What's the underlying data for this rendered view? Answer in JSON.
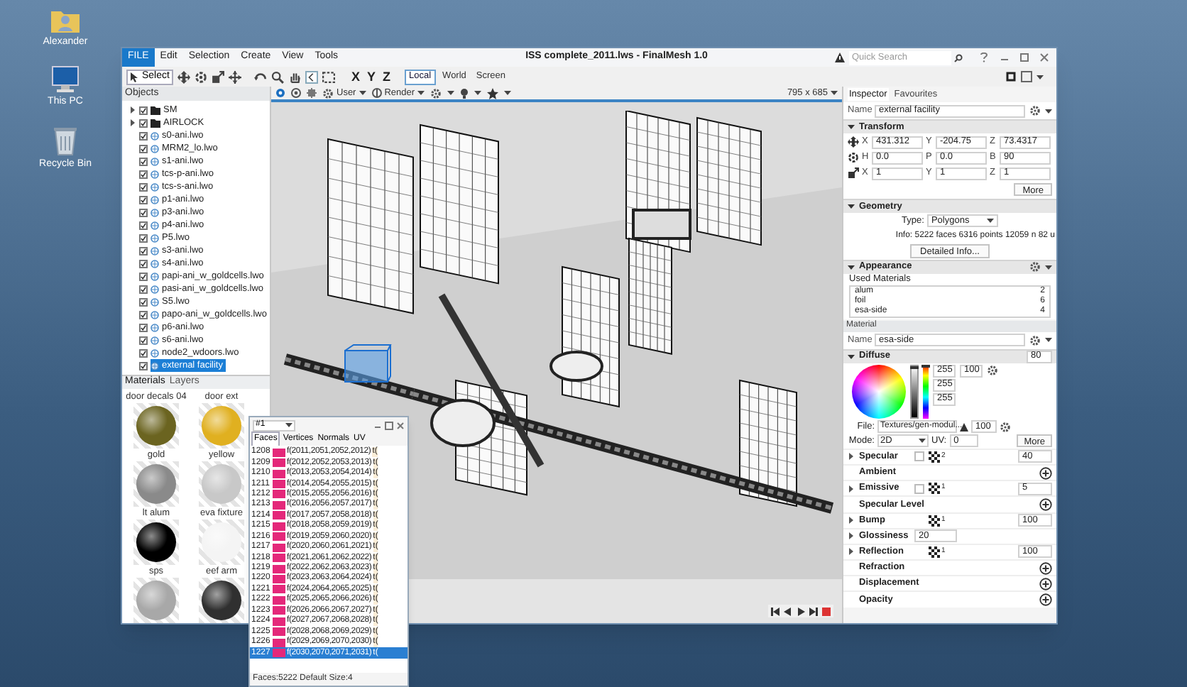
{
  "desktop_icons": [
    {
      "label": "Alexander",
      "kind": "user"
    },
    {
      "label": "This PC",
      "kind": "computer"
    },
    {
      "label": "Recycle Bin",
      "kind": "bin"
    }
  ],
  "window": {
    "title": "ISS complete_2011.lws - FinalMesh 1.0",
    "quick_search": {
      "placeholder": "Quick Search"
    },
    "menu": [
      {
        "label": "FILE",
        "selected": true
      },
      {
        "label": "Edit",
        "selected": false
      },
      {
        "label": "Selection",
        "selected": false
      },
      {
        "label": "Create",
        "selected": false
      },
      {
        "label": "View",
        "selected": false
      },
      {
        "label": "Tools",
        "selected": false
      }
    ]
  },
  "toolbar": {
    "select": "Select",
    "axes": [
      "X",
      "Y",
      "Z"
    ],
    "spaces": [
      {
        "label": "Local",
        "selected": true
      },
      {
        "label": "World",
        "selected": false
      },
      {
        "label": "Screen",
        "selected": false
      }
    ]
  },
  "objects": {
    "title": "Objects",
    "items": [
      {
        "label": "SM",
        "kind": "group",
        "expanded": false,
        "checked": true,
        "selected": false
      },
      {
        "label": "AIRLOCK",
        "kind": "group",
        "expanded": false,
        "checked": true,
        "selected": false
      },
      {
        "label": "s0-ani.lwo",
        "kind": "mesh",
        "checked": true,
        "selected": false
      },
      {
        "label": "MRM2_lo.lwo",
        "kind": "mesh",
        "checked": true,
        "selected": false
      },
      {
        "label": "s1-ani.lwo",
        "kind": "mesh",
        "checked": true,
        "selected": false
      },
      {
        "label": "tcs-p-ani.lwo",
        "kind": "mesh",
        "checked": true,
        "selected": false
      },
      {
        "label": "tcs-s-ani.lwo",
        "kind": "mesh",
        "checked": true,
        "selected": false
      },
      {
        "label": "p1-ani.lwo",
        "kind": "mesh",
        "checked": true,
        "selected": false
      },
      {
        "label": "p3-ani.lwo",
        "kind": "mesh",
        "checked": true,
        "selected": false
      },
      {
        "label": "p4-ani.lwo",
        "kind": "mesh",
        "checked": true,
        "selected": false
      },
      {
        "label": "P5.lwo",
        "kind": "mesh",
        "checked": true,
        "selected": false
      },
      {
        "label": "s3-ani.lwo",
        "kind": "mesh",
        "checked": true,
        "selected": false
      },
      {
        "label": "s4-ani.lwo",
        "kind": "mesh",
        "checked": true,
        "selected": false
      },
      {
        "label": "papi-ani_w_goldcells.lwo",
        "kind": "mesh",
        "checked": true,
        "selected": false
      },
      {
        "label": "pasi-ani_w_goldcells.lwo",
        "kind": "mesh",
        "checked": true,
        "selected": false
      },
      {
        "label": "S5.lwo",
        "kind": "mesh",
        "checked": true,
        "selected": false
      },
      {
        "label": "papo-ani_w_goldcells.lwo",
        "kind": "mesh",
        "checked": true,
        "selected": false
      },
      {
        "label": "p6-ani.lwo",
        "kind": "mesh",
        "checked": true,
        "selected": false
      },
      {
        "label": "s6-ani.lwo",
        "kind": "mesh",
        "checked": true,
        "selected": false
      },
      {
        "label": "node2_wdoors.lwo",
        "kind": "mesh",
        "checked": true,
        "selected": false
      },
      {
        "label": "external facility",
        "kind": "mesh",
        "checked": true,
        "selected": true
      }
    ]
  },
  "materials": {
    "tabs": [
      {
        "label": "Materials",
        "selected": true
      },
      {
        "label": "Layers",
        "selected": false
      }
    ],
    "items": [
      {
        "name": "door decals 04",
        "color": "#6b6420"
      },
      {
        "name": "door ext",
        "color": "#e0b020"
      },
      {
        "name": "gold",
        "color": "#8a8a8a"
      },
      {
        "name": "yellow",
        "color": "#c8c8c8"
      },
      {
        "name": "lt alum",
        "color": "#000000"
      },
      {
        "name": "eva fixture",
        "color": "#f4f4f4"
      },
      {
        "name": "sps",
        "color": "#a8a8a8"
      },
      {
        "name": "eef arm",
        "color": "#303030"
      }
    ]
  },
  "viewport": {
    "camera": "User",
    "render": "Render",
    "size": "795 x 685"
  },
  "faces_window": {
    "selector": "#1",
    "tabs": [
      {
        "label": "Faces",
        "selected": true
      },
      {
        "label": "Vertices",
        "selected": false
      },
      {
        "label": "Normals",
        "selected": false
      },
      {
        "label": "UV",
        "selected": false
      }
    ],
    "rows": [
      {
        "index": "1208",
        "face": "f(2011,2051,2052,2012)",
        "extra": "t(",
        "selected": false
      },
      {
        "index": "1209",
        "face": "f(2012,2052,2053,2013)",
        "extra": "t(",
        "selected": false
      },
      {
        "index": "1210",
        "face": "f(2013,2053,2054,2014)",
        "extra": "t(",
        "selected": false
      },
      {
        "index": "1211",
        "face": "f(2014,2054,2055,2015)",
        "extra": "t(",
        "selected": false
      },
      {
        "index": "1212",
        "face": "f(2015,2055,2056,2016)",
        "extra": "t(",
        "selected": false
      },
      {
        "index": "1213",
        "face": "f(2016,2056,2057,2017)",
        "extra": "t(",
        "selected": false
      },
      {
        "index": "1214",
        "face": "f(2017,2057,2058,2018)",
        "extra": "t(",
        "selected": false
      },
      {
        "index": "1215",
        "face": "f(2018,2058,2059,2019)",
        "extra": "t(",
        "selected": false
      },
      {
        "index": "1216",
        "face": "f(2019,2059,2060,2020)",
        "extra": "t(",
        "selected": false
      },
      {
        "index": "1217",
        "face": "f(2020,2060,2061,2021)",
        "extra": "t(",
        "selected": false
      },
      {
        "index": "1218",
        "face": "f(2021,2061,2062,2022)",
        "extra": "t(",
        "selected": false
      },
      {
        "index": "1219",
        "face": "f(2022,2062,2063,2023)",
        "extra": "t(",
        "selected": false
      },
      {
        "index": "1220",
        "face": "f(2023,2063,2064,2024)",
        "extra": "t(",
        "selected": false
      },
      {
        "index": "1221",
        "face": "f(2024,2064,2065,2025)",
        "extra": "t(",
        "selected": false
      },
      {
        "index": "1222",
        "face": "f(2025,2065,2066,2026)",
        "extra": "t(",
        "selected": false
      },
      {
        "index": "1223",
        "face": "f(2026,2066,2067,2027)",
        "extra": "t(",
        "selected": false
      },
      {
        "index": "1224",
        "face": "f(2027,2067,2068,2028)",
        "extra": "t(",
        "selected": false
      },
      {
        "index": "1225",
        "face": "f(2028,2068,2069,2029)",
        "extra": "t(",
        "selected": false
      },
      {
        "index": "1226",
        "face": "f(2029,2069,2070,2030)",
        "extra": "t(",
        "selected": false
      },
      {
        "index": "1227",
        "face": "f(2030,2070,2071,2031)",
        "extra": "t(",
        "selected": true
      }
    ],
    "footer": "Faces:5222 Default Size:4"
  },
  "inspector": {
    "tabs": [
      {
        "label": "Inspector",
        "selected": true
      },
      {
        "label": "Favourites",
        "selected": false
      }
    ],
    "name_label": "Name",
    "name": "external facility",
    "transform": {
      "title": "Transform",
      "rows": [
        [
          {
            "label": "X",
            "value": "431.312"
          },
          {
            "label": "Y",
            "value": "-204.75"
          },
          {
            "label": "Z",
            "value": "73.4317"
          }
        ],
        [
          {
            "label": "H",
            "value": "0.0"
          },
          {
            "label": "P",
            "value": "0.0"
          },
          {
            "label": "B",
            "value": "90"
          }
        ],
        [
          {
            "label": "X",
            "value": "1"
          },
          {
            "label": "Y",
            "value": "1"
          },
          {
            "label": "Z",
            "value": "1"
          }
        ]
      ],
      "more": "More"
    },
    "geometry": {
      "title": "Geometry",
      "type_label": "Type:",
      "type": "Polygons",
      "info": "Info: 5222 faces 6316 points 12059 n 82 u",
      "detail_button": "Detailed Info..."
    },
    "appearance": {
      "title": "Appearance",
      "used_label": "Used Materials",
      "materials": [
        {
          "name": "alum",
          "count": "2"
        },
        {
          "name": "foil",
          "count": "6"
        },
        {
          "name": "esa-side",
          "count": "4"
        }
      ]
    }
  },
  "material": {
    "title": "Material",
    "name_label": "Name",
    "name": "esa-side",
    "diffuse": {
      "title": "Diffuse",
      "value": "80",
      "brightness_slider": {
        "level": 1
      },
      "hue_slider": {
        "level": 1
      },
      "rgb": [
        "255",
        "255",
        "255"
      ],
      "alpha": "100",
      "file_label": "File:",
      "file": "Textures/gen-modul...",
      "file_value": "100",
      "mode_label": "Mode:",
      "mode": "2D",
      "uv_label": "UV:",
      "uv": "0",
      "more": "More"
    },
    "channels": [
      {
        "name": "Specular",
        "kind": "texture",
        "swatch": true,
        "maps": "2",
        "value": "40"
      },
      {
        "name": "Ambient",
        "kind": "add"
      },
      {
        "name": "Emissive",
        "kind": "texture",
        "swatch": true,
        "maps": "1",
        "value": "5"
      },
      {
        "name": "Specular Level",
        "kind": "add"
      },
      {
        "name": "Bump",
        "kind": "texture",
        "swatch": false,
        "maps": "1",
        "value": "100"
      },
      {
        "name": "Glossiness",
        "kind": "number",
        "value": "20"
      },
      {
        "name": "Reflection",
        "kind": "texture",
        "swatch": false,
        "maps": "1",
        "value": "100"
      },
      {
        "name": "Refraction",
        "kind": "add"
      },
      {
        "name": "Displacement",
        "kind": "add"
      },
      {
        "name": "Opacity",
        "kind": "add"
      }
    ]
  }
}
